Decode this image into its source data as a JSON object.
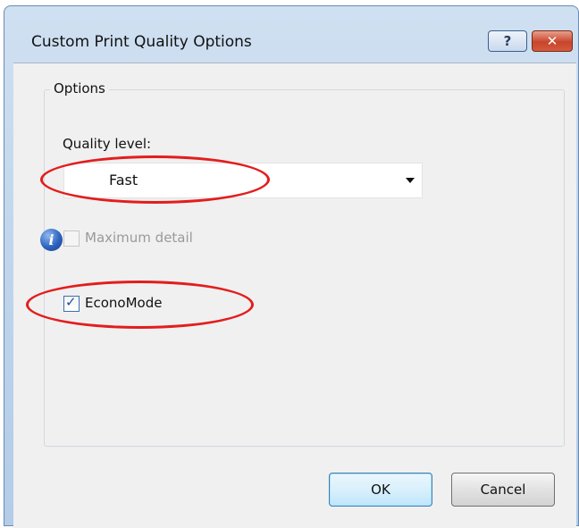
{
  "window": {
    "title": "Custom Print Quality Options",
    "help_label": "?",
    "close_label": "✕"
  },
  "options_group": {
    "legend": "Options",
    "quality_label": "Quality level:",
    "quality_value": "Fast",
    "maximum_detail_label": "Maximum detail",
    "maximum_detail_checked": false,
    "maximum_detail_enabled": false,
    "info_icon": "i",
    "econo_mode_label": "EconoMode",
    "econo_mode_checked": true
  },
  "buttons": {
    "ok_label": "OK",
    "cancel_label": "Cancel"
  },
  "colors": {
    "annotation": "#e31d1d",
    "titlebar": "#b9d1ea",
    "close_button": "#c8452b"
  }
}
